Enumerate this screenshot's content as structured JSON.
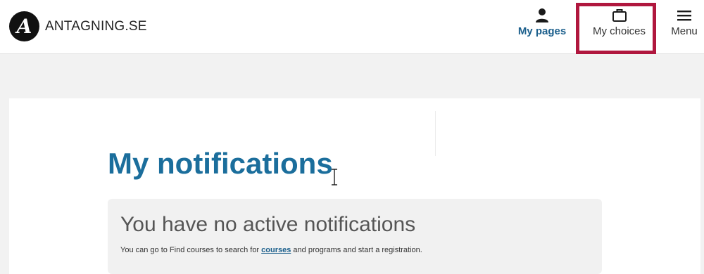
{
  "header": {
    "logo_letter": "A",
    "logo_text": "ANTAGNING.SE",
    "nav": {
      "my_pages": {
        "label": "My pages",
        "icon": "person-icon"
      },
      "my_choices": {
        "label": "My choices",
        "icon": "briefcase-icon"
      },
      "menu": {
        "label": "Menu",
        "icon": "hamburger-icon"
      }
    }
  },
  "colors": {
    "brand_blue": "#1b6e9c",
    "highlight_red": "#b0173e"
  },
  "main": {
    "title": "My notifications",
    "notice": {
      "heading": "You have no active notifications",
      "text_before": "You can go to Find courses to search for ",
      "link_text": "courses",
      "text_after": " and programs and start a registration."
    }
  }
}
